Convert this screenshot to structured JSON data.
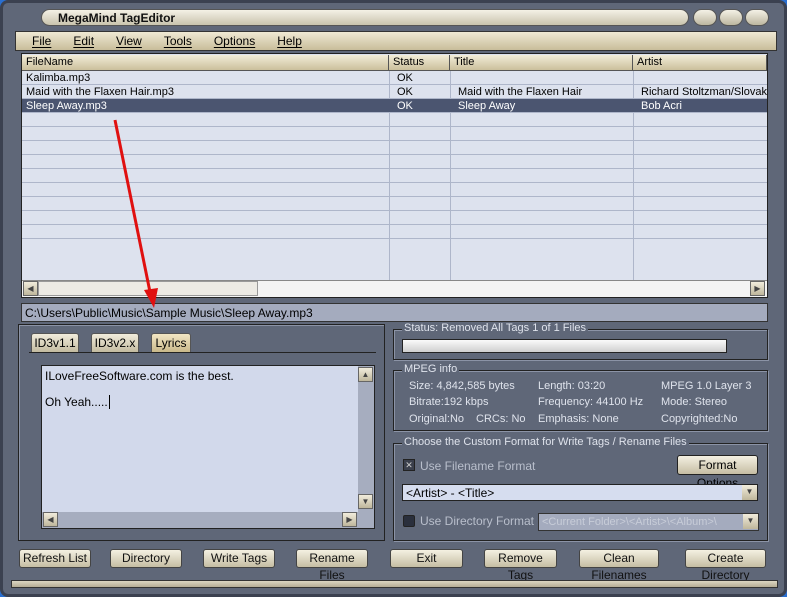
{
  "window": {
    "title": "MegaMind TagEditor"
  },
  "menu": [
    "File",
    "Edit",
    "View",
    "Tools",
    "Options",
    "Help"
  ],
  "list": {
    "columns": [
      "FileName",
      "Status",
      "Title",
      "Artist"
    ],
    "rows": [
      {
        "filename": "Kalimba.mp3",
        "status": "OK",
        "title": "",
        "artist": ""
      },
      {
        "filename": "Maid with the Flaxen Hair.mp3",
        "status": "OK",
        "title": "Maid with the Flaxen Hair",
        "artist": "Richard Stoltzman/Slovak"
      },
      {
        "filename": "Sleep Away.mp3",
        "status": "OK",
        "title": "Sleep Away",
        "artist": "Bob Acri"
      }
    ],
    "selected_index": 2
  },
  "path": "C:\\Users\\Public\\Music\\Sample Music\\Sleep Away.mp3",
  "tabs": [
    "ID3v1.1",
    "ID3v2.x",
    "Lyrics"
  ],
  "active_tab": "Lyrics",
  "lyrics": {
    "line1": "ILoveFreeSoftware.com is the best.",
    "line2": "Oh Yeah....."
  },
  "status": {
    "label": "Status: Removed All Tags 1 of 1 Files",
    "progress": 0
  },
  "mpeg": {
    "legend": "MPEG info",
    "size": "Size: 4,842,585 bytes",
    "length": "Length: 03:20",
    "version": "MPEG 1.0 Layer 3",
    "bitrate": "Bitrate:192 kbps",
    "frequency": "Frequency: 44100 Hz",
    "mode": "Mode: Stereo",
    "original": "Original:No",
    "crcs": "CRCs: No",
    "emphasis": "Emphasis: None",
    "copyrighted": "Copyrighted:No"
  },
  "format": {
    "legend": "Choose the Custom Format for Write Tags / Rename Files",
    "use_filename": "Use Filename Format",
    "format_options": "Format Options",
    "filename_format": "<Artist> - <Title>",
    "use_directory": "Use Directory Format",
    "directory_format": "<Current Folder>\\<Artist>\\<Album>\\"
  },
  "buttons": [
    "Refresh List",
    "Directory",
    "Write Tags",
    "Rename Files",
    "Exit",
    "Remove Tags",
    "Clean Filenames",
    "Create Directory"
  ],
  "colors": {
    "frame": "#5f6778",
    "selected": "#4b5570",
    "arrow": "#e01010"
  }
}
